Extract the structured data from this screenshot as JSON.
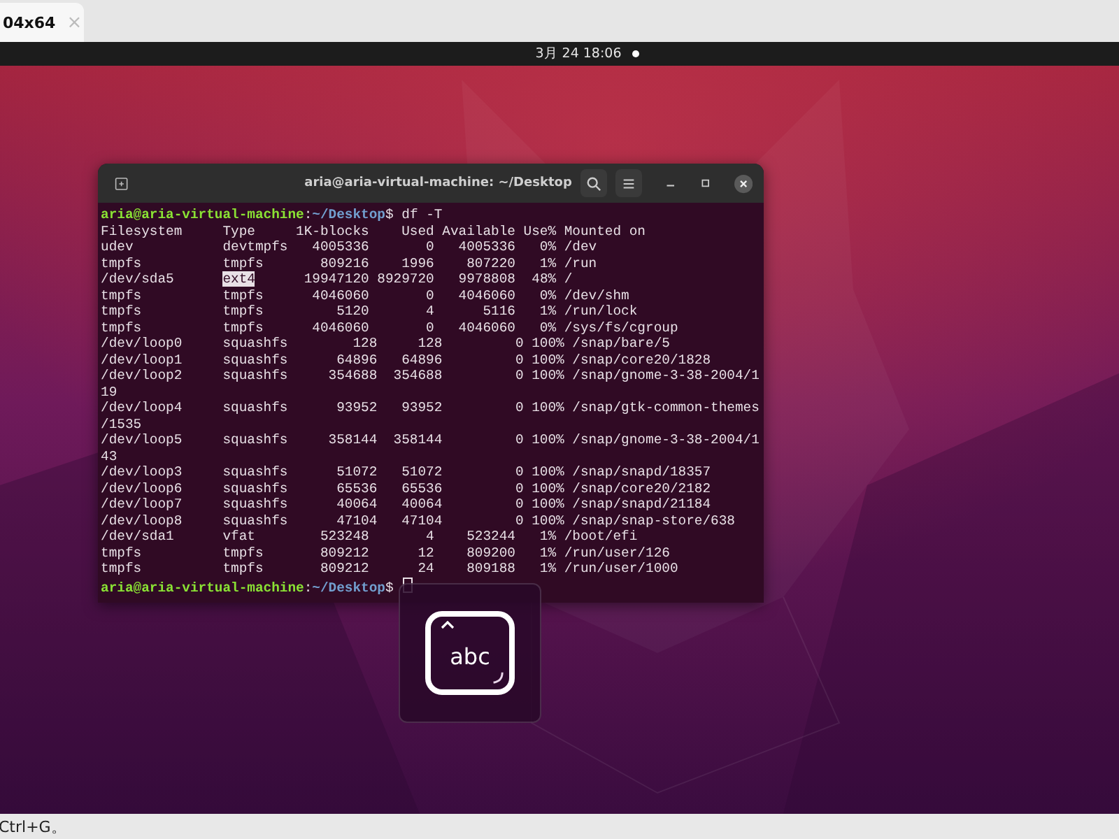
{
  "browser_tab": {
    "title": "04x64",
    "close": "×"
  },
  "top_bar": {
    "clock": "3月 24 18:06"
  },
  "terminal": {
    "title": "aria@aria-virtual-machine: ~/Desktop",
    "lines": [
      {
        "kind": "prompt",
        "user_host": "aria@aria-virtual-machine",
        "separator": ":",
        "path": "~/Desktop",
        "symbol": "$",
        "command": "df -T",
        "cursor": false
      },
      {
        "kind": "output",
        "text": "Filesystem     Type     1K-blocks    Used Available Use% Mounted on"
      },
      {
        "kind": "output",
        "text": "udev           devtmpfs   4005336       0   4005336   0% /dev"
      },
      {
        "kind": "output",
        "text": "tmpfs          tmpfs       809216    1996    807220   1% /run"
      },
      {
        "kind": "output",
        "segments": [
          {
            "text": "/dev/sda5      ",
            "highlighted": false
          },
          {
            "text": "ext4",
            "highlighted": true
          },
          {
            "text": "      19947120 8929720   9978808  48% /",
            "highlighted": false
          }
        ]
      },
      {
        "kind": "output",
        "text": "tmpfs          tmpfs      4046060       0   4046060   0% /dev/shm"
      },
      {
        "kind": "output",
        "text": "tmpfs          tmpfs         5120       4      5116   1% /run/lock"
      },
      {
        "kind": "output",
        "text": "tmpfs          tmpfs      4046060       0   4046060   0% /sys/fs/cgroup"
      },
      {
        "kind": "output",
        "text": "/dev/loop0     squashfs        128     128         0 100% /snap/bare/5"
      },
      {
        "kind": "output",
        "text": "/dev/loop1     squashfs      64896   64896         0 100% /snap/core20/1828"
      },
      {
        "kind": "output",
        "text": "/dev/loop2     squashfs     354688  354688         0 100% /snap/gnome-3-38-2004/1"
      },
      {
        "kind": "output",
        "text": "19"
      },
      {
        "kind": "output",
        "text": "/dev/loop4     squashfs      93952   93952         0 100% /snap/gtk-common-themes"
      },
      {
        "kind": "output",
        "text": "/1535"
      },
      {
        "kind": "output",
        "text": "/dev/loop5     squashfs     358144  358144         0 100% /snap/gnome-3-38-2004/1"
      },
      {
        "kind": "output",
        "text": "43"
      },
      {
        "kind": "output",
        "text": "/dev/loop3     squashfs      51072   51072         0 100% /snap/snapd/18357"
      },
      {
        "kind": "output",
        "text": "/dev/loop6     squashfs      65536   65536         0 100% /snap/core20/2182"
      },
      {
        "kind": "output",
        "text": "/dev/loop7     squashfs      40064   40064         0 100% /snap/snapd/21184"
      },
      {
        "kind": "output",
        "text": "/dev/loop8     squashfs      47104   47104         0 100% /snap/snap-store/638"
      },
      {
        "kind": "output",
        "text": "/dev/sda1      vfat        523248       4    523244   1% /boot/efi"
      },
      {
        "kind": "output",
        "text": "tmpfs          tmpfs       809212      12    809200   1% /run/user/126"
      },
      {
        "kind": "output",
        "text": "tmpfs          tmpfs       809212      24    809188   1% /run/user/1000"
      },
      {
        "kind": "prompt",
        "user_host": "aria@aria-virtual-machine",
        "separator": ":",
        "path": "~/Desktop",
        "symbol": "$",
        "cursor": true
      }
    ]
  },
  "input_method_popup": {
    "label": "abc"
  },
  "status_bar": {
    "text": "Ctrl+G。"
  }
}
